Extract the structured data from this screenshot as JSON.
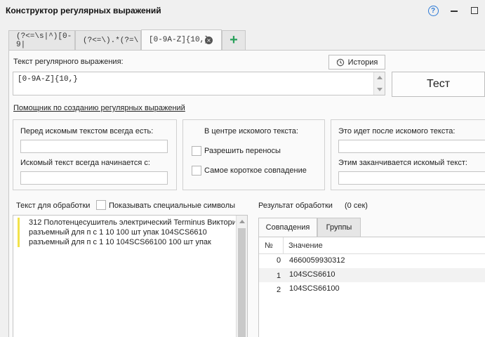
{
  "window": {
    "title": "Конструктор регулярных выражений",
    "help_glyph": "?"
  },
  "tabs": [
    {
      "label": "(?<=\\s|^)[0-9|"
    },
    {
      "label": "(?<=\\).*(?=\\"
    },
    {
      "label": "[0-9A-Z]{10,}"
    }
  ],
  "tab_close_glyph": "×",
  "tab_add_glyph": "+",
  "regex": {
    "label": "Текст регулярного выражения:",
    "history_button": "История",
    "value": "[0-9A-Z]{10,}",
    "test_button": "Тест"
  },
  "helper_link": "Помощник по созданию регулярных выражений",
  "helper": {
    "before_label": "Перед искомым текстом всегда есть:",
    "before_value": "",
    "starts_label": "Искомый текст всегда начинается с:",
    "starts_value": "",
    "center_label": "В центре искомого текста:",
    "allow_breaks_label": "Разрешить переносы",
    "shortest_label": "Самое короткое совпадение",
    "after_label": "Это идет после искомого текста:",
    "after_value": "",
    "ends_label": "Этим заканчивается искомый текст:",
    "ends_value": ""
  },
  "source": {
    "label": "Текст для обработки",
    "show_special_label": "Показывать специальные символы",
    "lines": [
      "312 Полотенцесушитель электрический Terminus Виктори",
      "разъемный для п с 1 10 100 шт упак 104SCS6610",
      "разъемный для п с 1 10 104SCS66100 100 шт упак"
    ]
  },
  "result": {
    "label": "Результат обработки",
    "time": "(0 сек)",
    "tabs": [
      "Совпадения",
      "Группы"
    ],
    "columns": [
      "№",
      "Значение"
    ],
    "rows": [
      {
        "n": "0",
        "value": "4660059930312"
      },
      {
        "n": "1",
        "value": "104SCS6610"
      },
      {
        "n": "2",
        "value": "104SCS66100"
      }
    ]
  }
}
